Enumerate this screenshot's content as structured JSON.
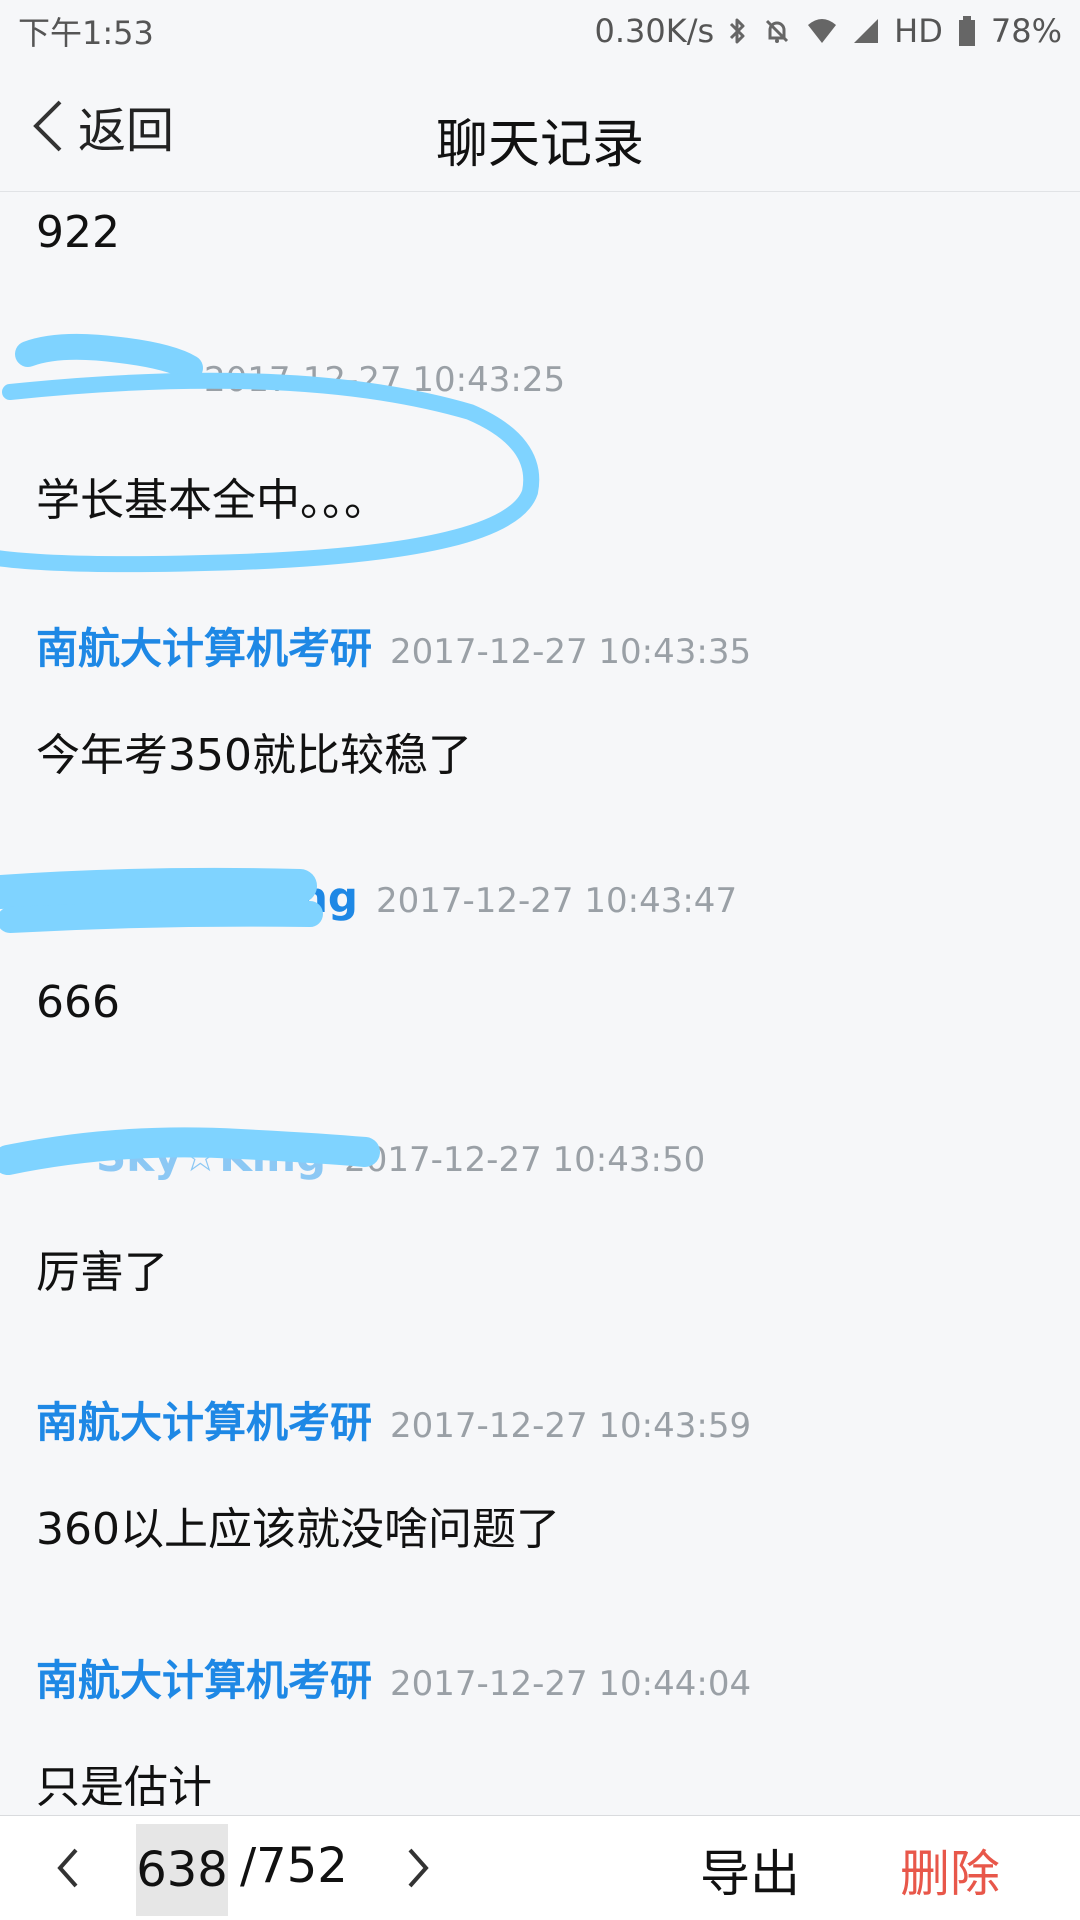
{
  "status_bar": {
    "time": "下午1:53",
    "speed": "0.30K/s",
    "network": "HD",
    "battery": "78%"
  },
  "header": {
    "back_label": "返回",
    "title": "聊天记录"
  },
  "messages": [
    {
      "sender": "",
      "timestamp": "",
      "content": "922"
    },
    {
      "sender": "",
      "timestamp": "2017-12-27 10:43:25",
      "content": "学长基本全中。。。"
    },
    {
      "sender": "南航大计算机考研",
      "timestamp": "2017-12-27 10:43:35",
      "content": "今年考350就比较稳了"
    },
    {
      "sender": "ng",
      "timestamp": "2017-12-27 10:43:47",
      "content": "666"
    },
    {
      "sender": "Sky☆King",
      "timestamp": "2017-12-27 10:43:50",
      "content": "厉害了"
    },
    {
      "sender": "南航大计算机考研",
      "timestamp": "2017-12-27 10:43:59",
      "content": "360以上应该就没啥问题了"
    },
    {
      "sender": "南航大计算机考研",
      "timestamp": "2017-12-27 10:44:04",
      "content": "只是估计"
    }
  ],
  "pagination": {
    "current": "638",
    "total": "/752"
  },
  "actions": {
    "export": "导出",
    "delete": "删除"
  },
  "colors": {
    "sender_blue": "#1e88e5",
    "timestamp_gray": "#9aa0a6",
    "delete_red": "#e8574a",
    "scribble_blue": "#7fd3ff"
  }
}
